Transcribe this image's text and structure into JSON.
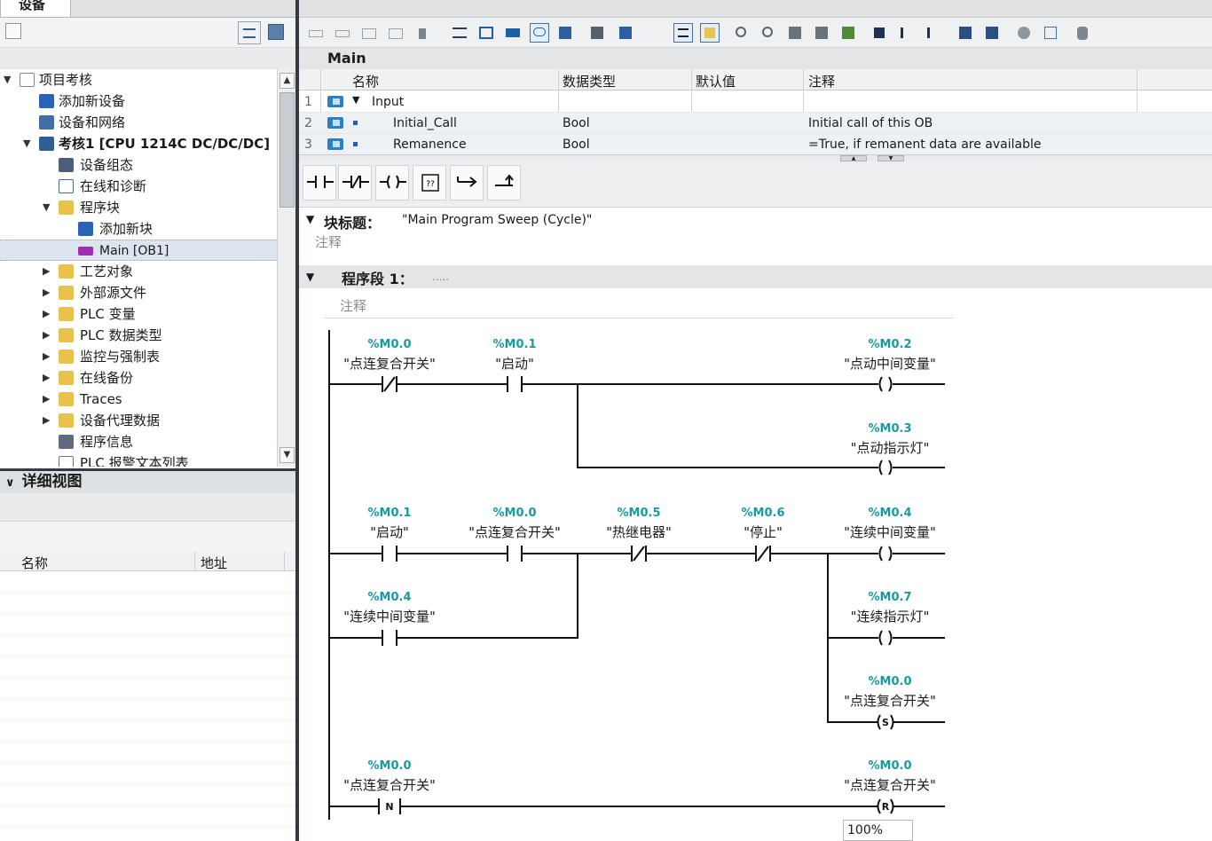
{
  "left_panel": {
    "tab_label": "设备",
    "tree": [
      {
        "label": "项目考核",
        "expanded": true
      },
      {
        "label": "添加新设备"
      },
      {
        "label": "设备和网络"
      },
      {
        "label": "考核1 [CPU 1214C DC/DC/DC]",
        "expanded": true
      },
      {
        "label": "设备组态"
      },
      {
        "label": "在线和诊断"
      },
      {
        "label": "程序块",
        "expanded": true
      },
      {
        "label": "添加新块"
      },
      {
        "label": "Main [OB1]",
        "selected": true
      },
      {
        "label": "工艺对象"
      },
      {
        "label": "外部源文件"
      },
      {
        "label": "PLC 变量"
      },
      {
        "label": "PLC 数据类型"
      },
      {
        "label": "监控与强制表"
      },
      {
        "label": "在线备份"
      },
      {
        "label": "Traces"
      },
      {
        "label": "设备代理数据"
      },
      {
        "label": "程序信息"
      },
      {
        "label": "PLC 报警文本列表"
      }
    ],
    "detail_view": {
      "title": "详细视图",
      "columns": [
        "名称",
        "地址"
      ]
    }
  },
  "editor": {
    "block_name": "Main",
    "interface": {
      "columns": [
        "名称",
        "数据类型",
        "默认值",
        "注释"
      ],
      "rows": [
        {
          "num": "1",
          "name": "Input",
          "type": "",
          "default": "",
          "comment": ""
        },
        {
          "num": "2",
          "name": "Initial_Call",
          "type": "Bool",
          "default": "",
          "comment": "Initial call of this OB"
        },
        {
          "num": "3",
          "name": "Remanence",
          "type": "Bool",
          "default": "",
          "comment": "=True, if remanent data are available"
        }
      ]
    },
    "block_title": {
      "label": "块标题：",
      "value": "\"Main Program Sweep (Cycle)\"",
      "comment": "注释"
    },
    "network": {
      "label": "程序段 1：",
      "dots": ".....",
      "comment": "注释"
    },
    "ladder": {
      "operands": {
        "r1_c1": {
          "tag": "%M0.0",
          "name": "\"点连复合开关\""
        },
        "r1_c2": {
          "tag": "%M0.1",
          "name": "\"启动\""
        },
        "r1_coil": {
          "tag": "%M0.2",
          "name": "\"点动中间变量\""
        },
        "r1b_coil": {
          "tag": "%M0.3",
          "name": "\"点动指示灯\""
        },
        "r2_c1": {
          "tag": "%M0.1",
          "name": "\"启动\""
        },
        "r2_c2": {
          "tag": "%M0.0",
          "name": "\"点连复合开关\""
        },
        "r2_c3": {
          "tag": "%M0.5",
          "name": "\"热继电器\""
        },
        "r2_c4": {
          "tag": "%M0.6",
          "name": "\"停止\""
        },
        "r2_coil": {
          "tag": "%M0.4",
          "name": "\"连续中间变量\""
        },
        "r2b_c1": {
          "tag": "%M0.4",
          "name": "\"连续中间变量\""
        },
        "r2b_coil": {
          "tag": "%M0.7",
          "name": "\"连续指示灯\""
        },
        "r2c_coil": {
          "tag": "%M0.0",
          "name": "\"点连复合开关\""
        },
        "r3_c1": {
          "tag": "%M0.0",
          "name": "\"点连复合开关\""
        },
        "r3_coil": {
          "tag": "%M0.0",
          "name": "\"点连复合开关\""
        }
      },
      "coil_letters": {
        "set": "S",
        "reset": "R",
        "neg": "N"
      }
    },
    "zoom": "100%"
  }
}
